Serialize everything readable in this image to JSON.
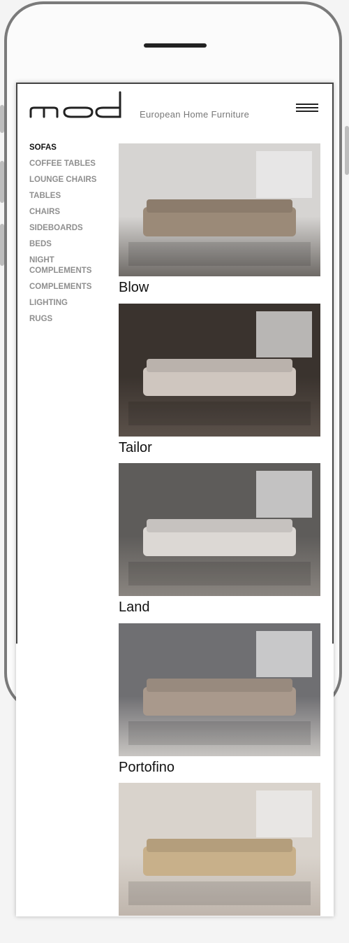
{
  "header": {
    "logo_text": "mod",
    "tagline": "European Home Furniture",
    "menu_icon": "hamburger-icon"
  },
  "nav": {
    "items": [
      {
        "label": "SOFAS",
        "active": true
      },
      {
        "label": "COFFEE TABLES"
      },
      {
        "label": "LOUNGE CHAIRS"
      },
      {
        "label": "TABLES"
      },
      {
        "label": "CHAIRS"
      },
      {
        "label": "SIDEBOARDS"
      },
      {
        "label": "BEDS"
      },
      {
        "label": "NIGHT COMPLEMENTS"
      },
      {
        "label": "COMPLEMENTS"
      },
      {
        "label": "LIGHTING"
      },
      {
        "label": "RUGS"
      }
    ]
  },
  "products": [
    {
      "name": "Blow",
      "colors": [
        "#d6d4d2",
        "#9b8a78",
        "#6e6a66"
      ]
    },
    {
      "name": "Tailor",
      "colors": [
        "#3a332e",
        "#cfc6bf",
        "#5b514a"
      ]
    },
    {
      "name": "Land",
      "colors": [
        "#5e5c5a",
        "#dcd8d4",
        "#8a8580"
      ]
    },
    {
      "name": "Portofino",
      "colors": [
        "#6f6f72",
        "#a9998c",
        "#c8c5c2"
      ]
    },
    {
      "name": "",
      "colors": [
        "#d9d3cc",
        "#c8b08a",
        "#bfb5ac"
      ]
    }
  ]
}
